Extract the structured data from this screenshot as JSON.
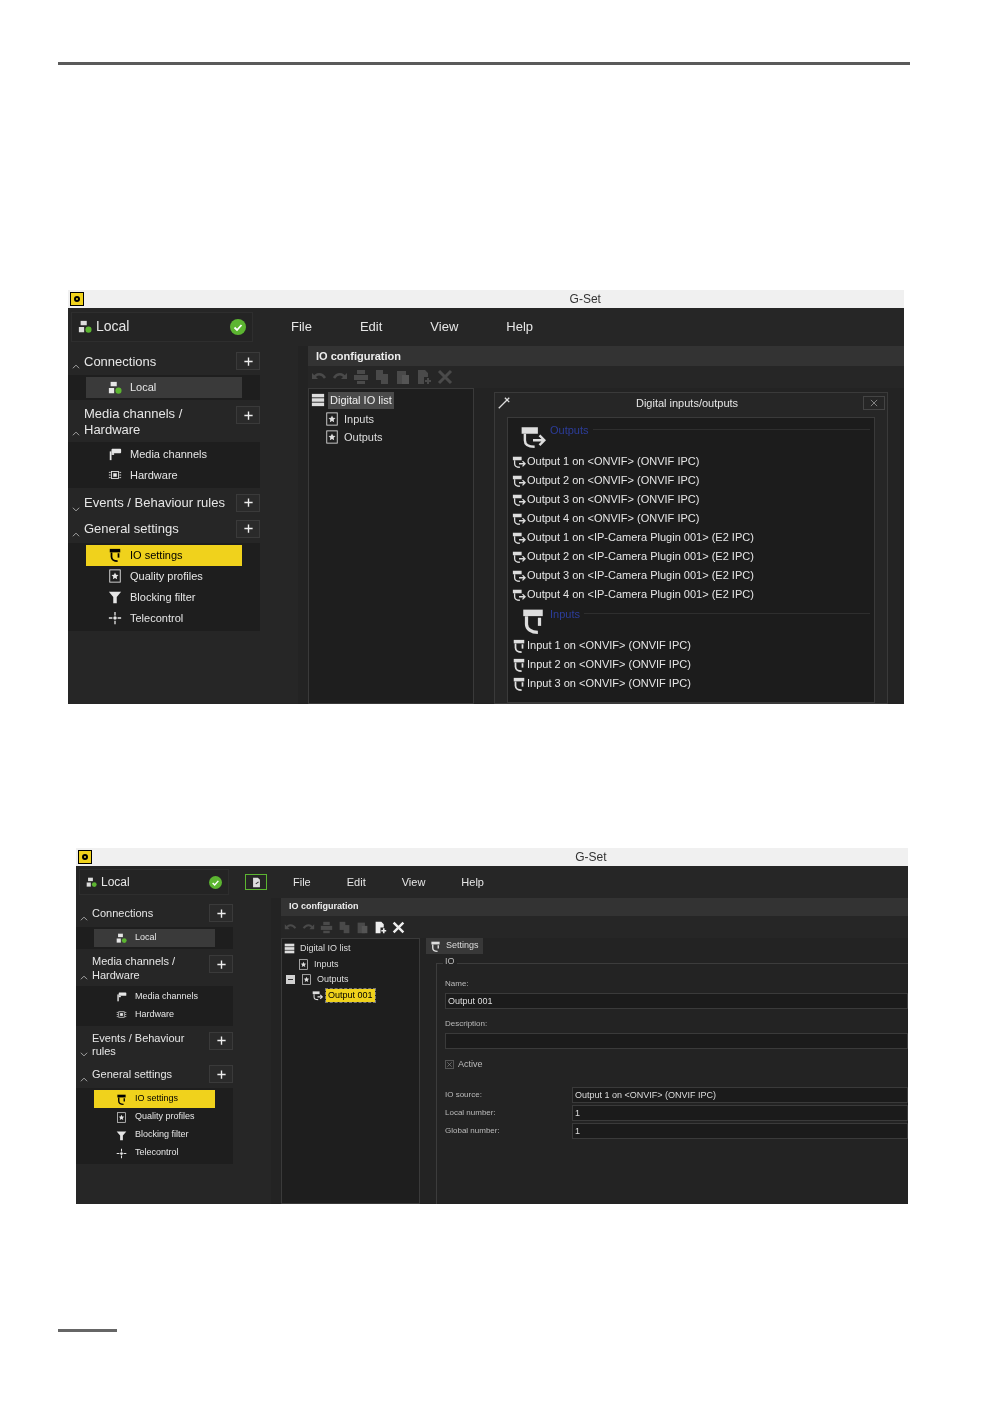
{
  "screenshots": [
    {
      "window": {
        "title": "G-Set"
      },
      "connection": {
        "label": "Local",
        "online": true
      },
      "menu": [
        "File",
        "Edit",
        "View",
        "Help"
      ],
      "sidebar": [
        {
          "title": "Connections",
          "expanded": true,
          "items": [
            {
              "label": "Local",
              "kind": "connection",
              "selected": false
            }
          ]
        },
        {
          "title": "Media channels / Hardware",
          "expanded": true,
          "items": [
            {
              "label": "Media channels",
              "kind": "camera",
              "selected": false
            },
            {
              "label": "Hardware",
              "kind": "chip",
              "selected": false
            }
          ]
        },
        {
          "title": "Events / Behaviour rules",
          "expanded": false
        },
        {
          "title": "General settings",
          "expanded": true,
          "items": [
            {
              "label": "IO settings",
              "kind": "io",
              "selected": true
            },
            {
              "label": "Quality profiles",
              "kind": "star",
              "selected": false
            },
            {
              "label": "Blocking filter",
              "kind": "filter",
              "selected": false
            },
            {
              "label": "Telecontrol",
              "kind": "telecontrol",
              "selected": false
            }
          ]
        }
      ],
      "panel": {
        "title": "IO configuration",
        "toolbar": [
          {
            "kind": "undo",
            "disabled": true
          },
          {
            "kind": "redo",
            "disabled": true
          },
          {
            "kind": "print",
            "disabled": true
          },
          {
            "kind": "copy",
            "disabled": true
          },
          {
            "kind": "paste",
            "disabled": true
          },
          {
            "kind": "add",
            "disabled": true
          },
          {
            "kind": "delete",
            "disabled": true
          }
        ],
        "tree": {
          "label": "Digital IO list",
          "selected": true,
          "children": [
            {
              "label": "Inputs",
              "selected": false
            },
            {
              "label": "Outputs",
              "selected": false
            }
          ]
        },
        "detail": {
          "kind": "dialog",
          "title": "Digital inputs/outputs",
          "groups": [
            {
              "title": "Outputs",
              "kind": "output",
              "items": [
                "Output 1 on <ONVIF> (ONVIF IPC)",
                "Output 2 on <ONVIF> (ONVIF IPC)",
                "Output 3 on <ONVIF> (ONVIF IPC)",
                "Output 4 on <ONVIF> (ONVIF IPC)",
                "Output 1 on <IP-Camera Plugin 001> (E2 IPC)",
                "Output 2 on <IP-Camera Plugin 001> (E2 IPC)",
                "Output 3 on <IP-Camera Plugin 001> (E2 IPC)",
                "Output 4 on <IP-Camera Plugin 001> (E2 IPC)"
              ]
            },
            {
              "title": "Inputs",
              "kind": "input",
              "items": [
                "Input 1 on <ONVIF> (ONVIF IPC)",
                "Input 2 on <ONVIF> (ONVIF IPC)",
                "Input 3 on <ONVIF> (ONVIF IPC)"
              ]
            }
          ]
        }
      }
    },
    {
      "window": {
        "title": "G-Set"
      },
      "connection": {
        "label": "Local",
        "online": true
      },
      "header_button": {
        "kind": "export"
      },
      "menu": [
        "File",
        "Edit",
        "View",
        "Help"
      ],
      "sidebar": [
        {
          "title": "Connections",
          "expanded": true,
          "items": [
            {
              "label": "Local",
              "kind": "connection",
              "selected": false
            }
          ]
        },
        {
          "title": "Media channels / Hardware",
          "expanded": true,
          "items": [
            {
              "label": "Media channels",
              "kind": "camera",
              "selected": false
            },
            {
              "label": "Hardware",
              "kind": "chip",
              "selected": false
            }
          ]
        },
        {
          "title": "Events / Behaviour rules",
          "expanded": false
        },
        {
          "title": "General settings",
          "expanded": true,
          "items": [
            {
              "label": "IO settings",
              "kind": "io",
              "selected": true
            },
            {
              "label": "Quality profiles",
              "kind": "star",
              "selected": false
            },
            {
              "label": "Blocking filter",
              "kind": "filter",
              "selected": false
            },
            {
              "label": "Telecontrol",
              "kind": "telecontrol",
              "selected": false
            }
          ]
        }
      ],
      "panel": {
        "title": "IO configuration",
        "toolbar": [
          {
            "kind": "undo",
            "disabled": true
          },
          {
            "kind": "redo",
            "disabled": true
          },
          {
            "kind": "print",
            "disabled": true
          },
          {
            "kind": "copy",
            "disabled": true
          },
          {
            "kind": "paste",
            "disabled": true
          },
          {
            "kind": "add",
            "disabled": false
          },
          {
            "kind": "delete",
            "disabled": false
          }
        ],
        "tree": {
          "label": "Digital IO list",
          "selected": false,
          "children": [
            {
              "label": "Inputs",
              "selected": false
            },
            {
              "label": "Outputs",
              "selected": false,
              "expanded": true,
              "children": [
                {
                  "label": "Output 001",
                  "selected": true
                }
              ]
            }
          ]
        },
        "detail": {
          "kind": "form",
          "tab": "Settings",
          "group": "IO",
          "fields": [
            {
              "kind": "stacked",
              "label": "Name:",
              "value": "Output 001"
            },
            {
              "kind": "stacked",
              "label": "Description:"
            },
            {
              "kind": "checkbox",
              "label": "Active",
              "checked": true
            },
            {
              "kind": "inline",
              "label": "IO source:",
              "value": "Output 1 on <ONVIF> (ONVIF IPC)"
            },
            {
              "kind": "inline",
              "label": "Local number:",
              "value": "1"
            },
            {
              "kind": "inline",
              "label": "Global number:",
              "value": "1"
            }
          ]
        }
      }
    }
  ]
}
